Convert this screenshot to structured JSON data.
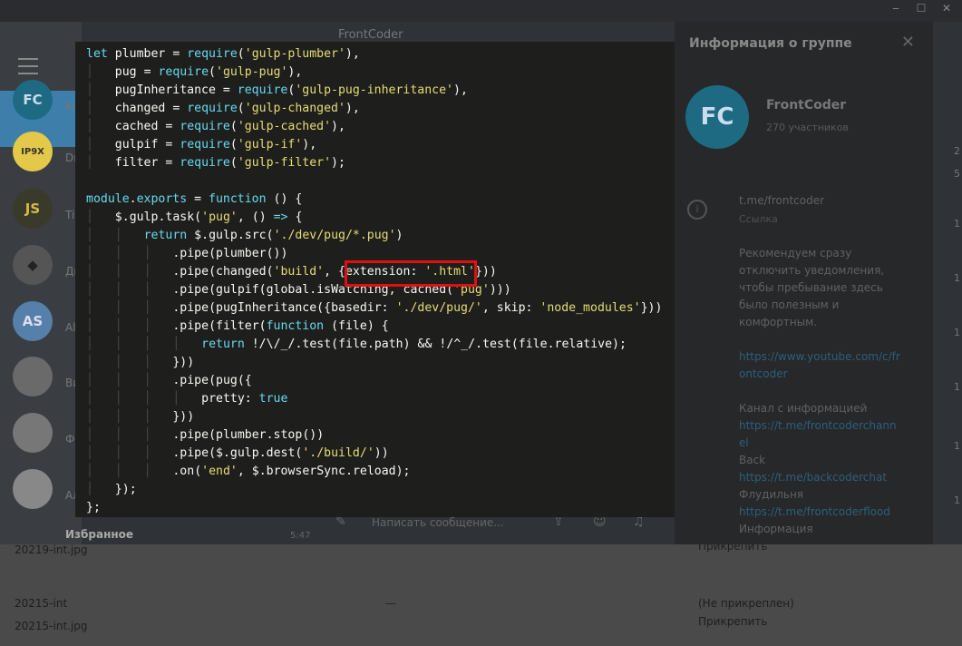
{
  "telegram": {
    "chat_title": "FrontCoder",
    "window_controls": [
      "‒",
      "☐",
      "✕"
    ],
    "chats": [
      {
        "initials": "FC",
        "name_stub": "kiri",
        "bg": "#1d6a82",
        "fg": "#cde"
      },
      {
        "initials": "IP9X",
        "name_stub": "Dm",
        "bg": "#e4c84a",
        "fg": "#333"
      },
      {
        "initials": "JS",
        "name_stub": "Tim",
        "bg": "#3a3a2a",
        "fg": "#d8b84a"
      },
      {
        "initials": "◆",
        "name_stub": "Дм",
        "bg": "#555",
        "fg": "#222"
      },
      {
        "initials": "AS",
        "name_stub": "Ale",
        "bg": "#5580aa",
        "fg": "#dde"
      },
      {
        "initials": "",
        "name_stub": "Ви",
        "bg": "#6a6a6a",
        "fg": "#222"
      },
      {
        "initials": "",
        "name_stub": "Фо",
        "bg": "#777",
        "fg": "#222"
      },
      {
        "initials": "",
        "name_stub": "Ал",
        "bg": "#888",
        "fg": "#222"
      }
    ],
    "favorites_label": "Избранное",
    "favorites_time": "5:47",
    "compose_placeholder": "Написать сообщение...",
    "right_panel": {
      "title": "Информация о группе",
      "group_initials": "FC",
      "group_name": "FrontCoder",
      "members": "270 участников",
      "link": "t.me/frontcoder",
      "link_caption": "Ссылка",
      "description_lines": [
        "Рекомендуем сразу",
        "отключить уведомления,",
        "чтобы пребывание здесь",
        "было полезным и",
        "комфортным."
      ],
      "youtube_lines": [
        "https://www.youtube.com/c/fr",
        "ontcoder"
      ],
      "channel_label": "Канал с информацией",
      "channel_lines": [
        "https://t.me/frontcoderchann",
        "el"
      ],
      "back_label": "Back",
      "back_link": "https://t.me/backcoderchat",
      "flood_label": "Флудильня",
      "flood_link": "https://t.me/frontcoderflood",
      "info_label": "Информация"
    },
    "edge_numbers": [
      "2",
      "5",
      "1",
      "1",
      "1",
      "1",
      "1",
      "1"
    ]
  },
  "files": {
    "row1_name": "20219-int.jpg",
    "row1_status": "Прикрепить",
    "row2_name": "20215-int",
    "row2_dash": "—",
    "row2_status": "(Не прикреплен)",
    "row3_name": "20215-int.jpg",
    "row3_status": "Прикрепить"
  },
  "code": {
    "language": "javascript",
    "highlighted_text": "'./dev/pug/*.pug'",
    "lines": [
      "let plumber = require('gulp-plumber'),",
      "    pug = require('gulp-pug'),",
      "    pugInheritance = require('gulp-pug-inheritance'),",
      "    changed = require('gulp-changed'),",
      "    cached = require('gulp-cached'),",
      "    gulpif = require('gulp-if'),",
      "    filter = require('gulp-filter');",
      "",
      "module.exports = function () {",
      "    $.gulp.task('pug', () => {",
      "        return $.gulp.src('./dev/pug/*.pug')",
      "            .pipe(plumber())",
      "            .pipe(changed('build', {extension: '.html'}))",
      "            .pipe(gulpif(global.isWatching, cached('pug')))",
      "            .pipe(pugInheritance({basedir: './dev/pug/', skip: 'node_modules'}))",
      "            .pipe(filter(function (file) {",
      "                return !/\\/_/.test(file.path) && !/^_/.test(file.relative);",
      "            }))",
      "            .pipe(pug({",
      "                pretty: true",
      "            }))",
      "            .pipe(plumber.stop())",
      "            .pipe($.gulp.dest('./build/'))",
      "            .on('end', $.browserSync.reload);",
      "    });",
      "};"
    ]
  }
}
